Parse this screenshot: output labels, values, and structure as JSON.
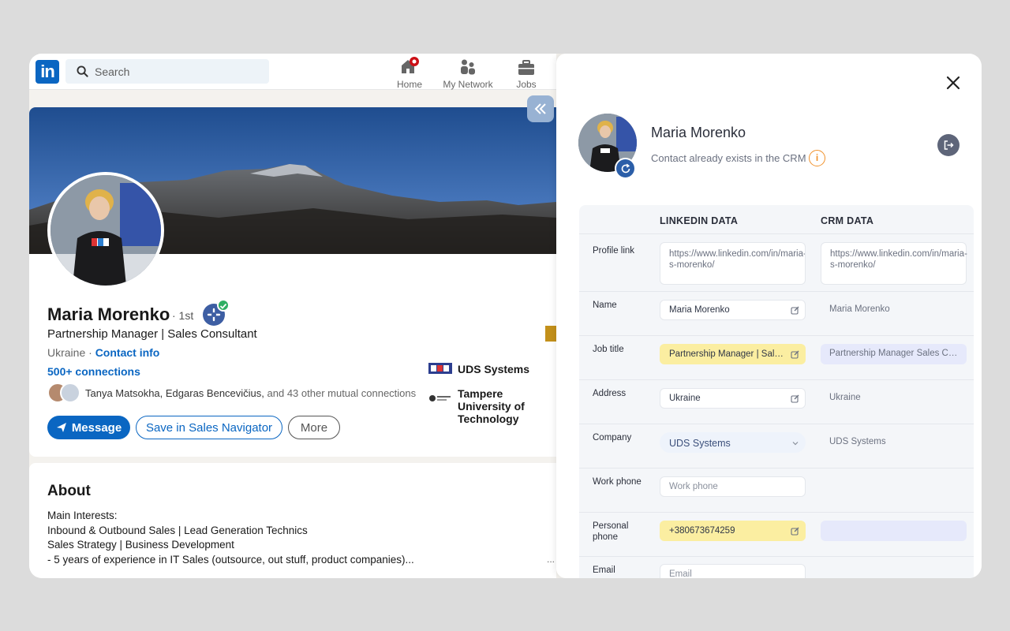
{
  "linkedin": {
    "logo": "in",
    "search": {
      "placeholder": "Search",
      "icon": "search-icon"
    },
    "nav": [
      {
        "label": "Home",
        "icon": "home-icon",
        "badge_color": "#cc1016"
      },
      {
        "label": "My Network",
        "icon": "network-icon"
      },
      {
        "label": "Jobs",
        "icon": "briefcase-icon"
      }
    ],
    "profile": {
      "name": "Maria Morenko",
      "degree": "· 1st",
      "headline": "Partnership Manager | Sales Consultant",
      "location": "Ukraine ·",
      "contact_info": "Contact info",
      "connections": "500+ connections",
      "mutual_names": "Tanya Matsokha, Edgaras Bencevičius,",
      "mutual_rest": " and 43 other mutual connections",
      "buttons": {
        "message": "Message",
        "save": "Save in Sales Navigator",
        "more": "More"
      },
      "experience": [
        {
          "name": "UDS Systems"
        },
        {
          "name": "Tampere University of",
          "name2": "Technology"
        }
      ]
    },
    "about": {
      "title": "About",
      "lines": [
        "Main Interests:",
        "Inbound & Outbound Sales | Lead Generation Technics",
        "Sales Strategy | Business Development",
        "- 5 years of experience in IT Sales (outsource, out stuff, product companies)..."
      ],
      "more": "..."
    },
    "colors": {
      "brand": "#0a66c2"
    }
  },
  "crm": {
    "name": "Maria Morenko",
    "status": "Contact already exists in the CRM",
    "info_glyph": "i",
    "columns": {
      "linkedin": "LINKEDIN DATA",
      "crm": "CRM DATA"
    },
    "rows": {
      "profile_link": {
        "label": "Profile link",
        "linkedin": "https://www.linkedin.com/in/maria-s-morenko/",
        "crm": "https://www.linkedin.com/in/maria-s-morenko/"
      },
      "name": {
        "label": "Name",
        "linkedin": "Maria Morenko",
        "crm": "Maria Morenko"
      },
      "job_title": {
        "label": "Job title",
        "linkedin": "Partnership Manager | Sales Consultant",
        "crm": "Partnership Manager Sales Consultant"
      },
      "address": {
        "label": "Address",
        "linkedin": "Ukraine",
        "crm": "Ukraine"
      },
      "company": {
        "label": "Company",
        "linkedin": "UDS Systems",
        "crm": "UDS Systems"
      },
      "work_phone": {
        "label": "Work phone",
        "placeholder": "Work phone"
      },
      "personal_phone": {
        "label": "Personal phone",
        "linkedin": "+380673674259",
        "crm": ""
      },
      "email": {
        "label": "Email",
        "placeholder": "Email"
      }
    },
    "colors": {
      "highlight": "#fbeea1",
      "crm_diff": "#e6e9fb",
      "warning": "#f0922c"
    }
  }
}
